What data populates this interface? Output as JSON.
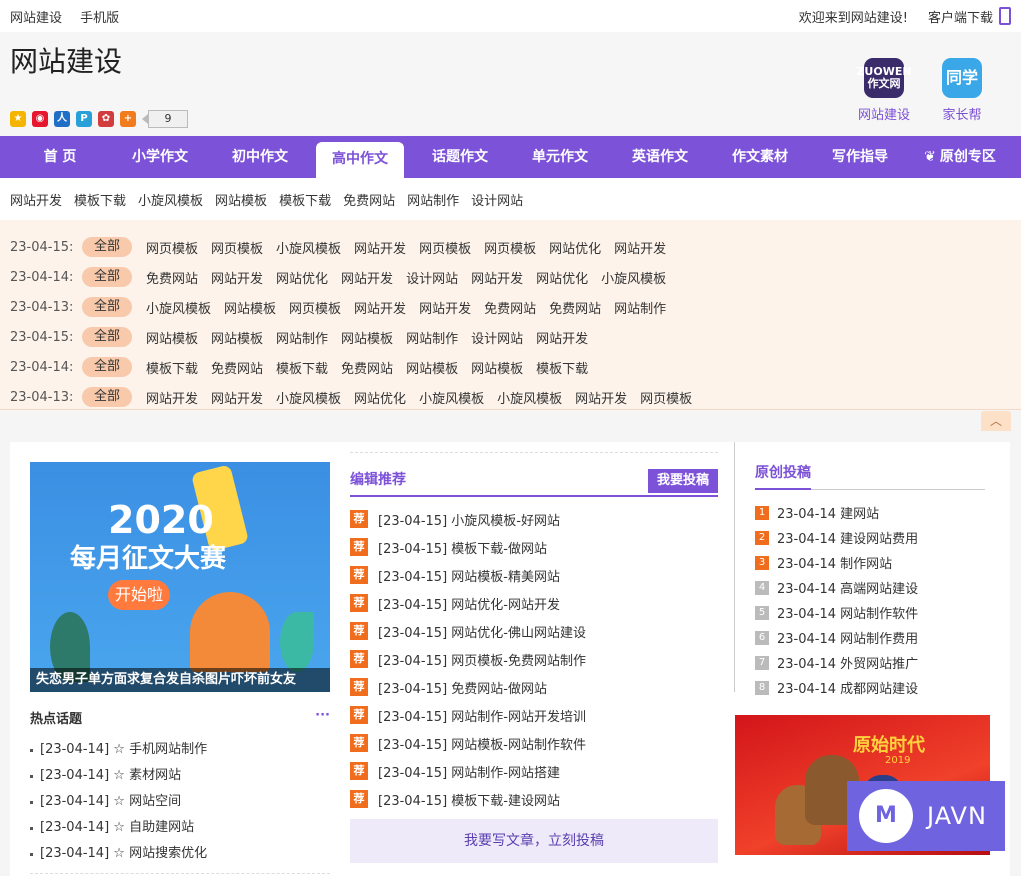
{
  "topbar": {
    "links": [
      "网站建设",
      "手机版"
    ],
    "welcome": "欢迎来到网站建设!",
    "client_download": "客户端下载"
  },
  "header": {
    "site_title": "网站建设",
    "share_count": "9",
    "share_icons": [
      "qzone-icon",
      "weibo-icon",
      "renren-icon",
      "pinterest-icon",
      "douban-icon",
      "more-share-icon"
    ],
    "apps": [
      {
        "logo_text": "ZUOWEN 作文网",
        "label": "网站建设",
        "color": "#3a2b6b"
      },
      {
        "logo_text": "同学",
        "label": "家长帮",
        "color": "#39a7e8"
      }
    ]
  },
  "nav": {
    "items": [
      "首 页",
      "小学作文",
      "初中作文",
      "高中作文",
      "话题作文",
      "单元作文",
      "英语作文",
      "作文素材",
      "写作指导",
      "原创专区"
    ],
    "active_index": 3
  },
  "tagline": [
    "网站开发",
    "模板下载",
    "小旋风模板",
    "网站模板",
    "模板下载",
    "免费网站",
    "网站制作",
    "设计网站"
  ],
  "date_rows": [
    {
      "date": "23-04-15:",
      "all": "全部",
      "tags": [
        "网页模板",
        "网页模板",
        "小旋风模板",
        "网站开发",
        "网页模板",
        "网页模板",
        "网站优化",
        "网站开发"
      ]
    },
    {
      "date": "23-04-14:",
      "all": "全部",
      "tags": [
        "免费网站",
        "网站开发",
        "网站优化",
        "网站开发",
        "设计网站",
        "网站开发",
        "网站优化",
        "小旋风模板"
      ]
    },
    {
      "date": "23-04-13:",
      "all": "全部",
      "tags": [
        "小旋风模板",
        "网站模板",
        "网页模板",
        "网站开发",
        "网站开发",
        "免费网站",
        "免费网站",
        "网站制作"
      ]
    },
    {
      "date": "23-04-15:",
      "all": "全部",
      "tags": [
        "网站模板",
        "网站模板",
        "网站制作",
        "网站模板",
        "网站制作",
        "设计网站",
        "网站开发"
      ]
    },
    {
      "date": "23-04-14:",
      "all": "全部",
      "tags": [
        "模板下载",
        "免费网站",
        "模板下载",
        "免费网站",
        "网站模板",
        "网站模板",
        "模板下载"
      ]
    },
    {
      "date": "23-04-13:",
      "all": "全部",
      "tags": [
        "网站开发",
        "网站开发",
        "小旋风模板",
        "网站优化",
        "小旋风模板",
        "小旋风模板",
        "网站开发",
        "网页模板"
      ]
    }
  ],
  "banner": {
    "year": "2020",
    "contest": "每月征文大赛",
    "start": "开始啦",
    "caption": "失恋男子单方面求复合发自杀图片吓坏前女友"
  },
  "hot": {
    "title": "热点话题",
    "more": "···",
    "items": [
      "[23-04-14] ☆ 手机网站制作",
      "[23-04-14] ☆ 素材网站",
      "[23-04-14] ☆ 网站空间",
      "[23-04-14] ☆ 自助建网站",
      "[23-04-14] ☆ 网站搜索优化"
    ]
  },
  "editor": {
    "title": "编辑推荐",
    "submit": "我要投稿",
    "badge": "荐",
    "items": [
      "[23-04-15] 小旋风模板-好网站",
      "[23-04-15] 模板下载-做网站",
      "[23-04-15] 网站模板-精美网站",
      "[23-04-15] 网站优化-网站开发",
      "[23-04-15] 网站优化-佛山网站建设",
      "[23-04-15] 网页模板-免费网站制作",
      "[23-04-15] 免费网站-做网站",
      "[23-04-15] 网站制作-网站开发培训",
      "[23-04-15] 网站模板-网站制作软件",
      "[23-04-15] 网站制作-网站搭建",
      "[23-04-15] 模板下载-建设网站"
    ],
    "write_bar": "我要写文章，立刻投稿"
  },
  "original": {
    "title": "原创投稿",
    "items": [
      {
        "num": "1",
        "text": "23-04-14 建网站"
      },
      {
        "num": "2",
        "text": "23-04-14 建设网站费用"
      },
      {
        "num": "3",
        "text": "23-04-14 制作网站"
      },
      {
        "num": "4",
        "text": "23-04-14 高端网站建设"
      },
      {
        "num": "5",
        "text": "23-04-14 网站制作软件"
      },
      {
        "num": "6",
        "text": "23-04-14 网站制作费用"
      },
      {
        "num": "7",
        "text": "23-04-14 外贸网站推广"
      },
      {
        "num": "8",
        "text": "23-04-14 成都网站建设"
      }
    ]
  },
  "poster": {
    "title": "原始时代",
    "year": "2019"
  },
  "watermark": {
    "text": "JAVN"
  },
  "colors": {
    "brand": "#7c52d8",
    "accent": "#f06d1e",
    "tag_bg": "#fdf3eb"
  }
}
